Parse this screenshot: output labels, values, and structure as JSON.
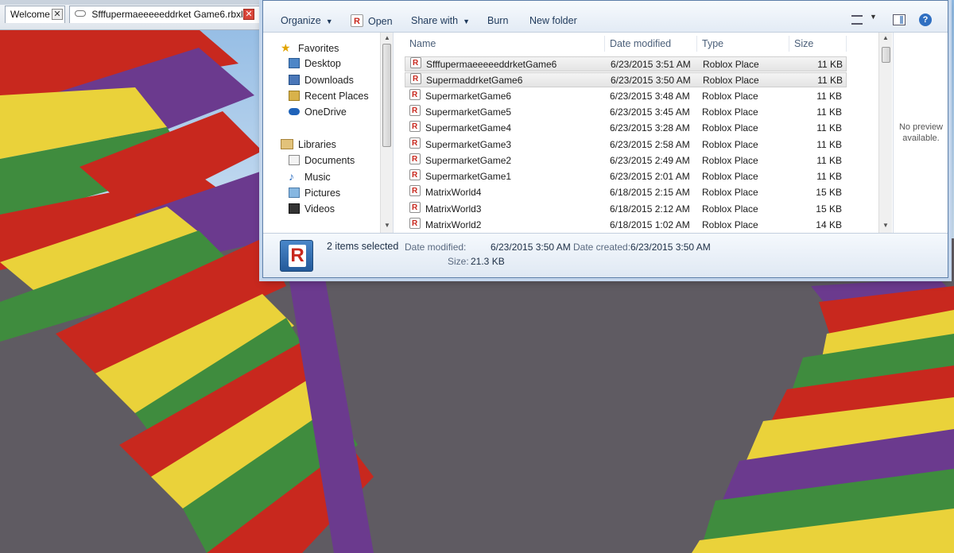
{
  "studio": {
    "tabs": [
      {
        "label": "Welcome"
      },
      {
        "label": "Sfffupermaeeeeeddrket Game6.rbxl"
      }
    ],
    "close_glyph": "✕"
  },
  "toolbar": {
    "organize": "Organize",
    "open": "Open",
    "share_with": "Share with",
    "burn": "Burn",
    "new_folder": "New folder",
    "dropdown_glyph": "▼",
    "help_glyph": "?"
  },
  "nav": {
    "groups": [
      {
        "label": "Favorites",
        "icon": "star-icon",
        "items": [
          "Desktop",
          "Downloads",
          "Recent Places",
          "OneDrive"
        ]
      },
      {
        "label": "Libraries",
        "icon": "library-icon",
        "items": [
          "Documents",
          "Music",
          "Pictures",
          "Videos"
        ]
      }
    ],
    "up_glyph": "▲",
    "down_glyph": "▼"
  },
  "file_list": {
    "columns": {
      "name": "Name",
      "date": "Date modified",
      "type": "Type",
      "size": "Size"
    },
    "rows": [
      {
        "name": "SfffupermaeeeeeddrketGame6",
        "date": "6/23/2015 3:51 AM",
        "type": "Roblox Place",
        "size": "11 KB",
        "selected": true
      },
      {
        "name": "SupermaddrketGame6",
        "date": "6/23/2015 3:50 AM",
        "type": "Roblox Place",
        "size": "11 KB",
        "selected": true
      },
      {
        "name": "SupermarketGame6",
        "date": "6/23/2015 3:48 AM",
        "type": "Roblox Place",
        "size": "11 KB",
        "selected": false
      },
      {
        "name": "SupermarketGame5",
        "date": "6/23/2015 3:45 AM",
        "type": "Roblox Place",
        "size": "11 KB",
        "selected": false
      },
      {
        "name": "SupermarketGame4",
        "date": "6/23/2015 3:28 AM",
        "type": "Roblox Place",
        "size": "11 KB",
        "selected": false
      },
      {
        "name": "SupermarketGame3",
        "date": "6/23/2015 2:58 AM",
        "type": "Roblox Place",
        "size": "11 KB",
        "selected": false
      },
      {
        "name": "SupermarketGame2",
        "date": "6/23/2015 2:49 AM",
        "type": "Roblox Place",
        "size": "11 KB",
        "selected": false
      },
      {
        "name": "SupermarketGame1",
        "date": "6/23/2015 2:01 AM",
        "type": "Roblox Place",
        "size": "11 KB",
        "selected": false
      },
      {
        "name": "MatrixWorld4",
        "date": "6/18/2015 2:15 AM",
        "type": "Roblox Place",
        "size": "15 KB",
        "selected": false
      },
      {
        "name": "MatrixWorld3",
        "date": "6/18/2015 2:12 AM",
        "type": "Roblox Place",
        "size": "15 KB",
        "selected": false
      },
      {
        "name": "MatrixWorld2",
        "date": "6/18/2015 1:02 AM",
        "type": "Roblox Place",
        "size": "14 KB",
        "selected": false
      }
    ],
    "file_icon_glyph": "R"
  },
  "preview": {
    "text": "No preview available."
  },
  "details": {
    "icon_glyph": "R",
    "selected_count": "2 items selected",
    "modified_label": "Date modified:",
    "modified_value": "6/23/2015 3:50 AM",
    "created_label": "Date created:",
    "created_value": "6/23/2015 3:50 AM",
    "size_label": "Size:",
    "size_value": "21.3 KB"
  },
  "colors": {
    "red": "#c8281e",
    "yellow": "#ead23a",
    "green": "#3f8c3e",
    "purple": "#6b3a8e",
    "baseplate": "#5f5b62",
    "sky": "#aacbea",
    "selection_bg": "#e6e6e6"
  }
}
